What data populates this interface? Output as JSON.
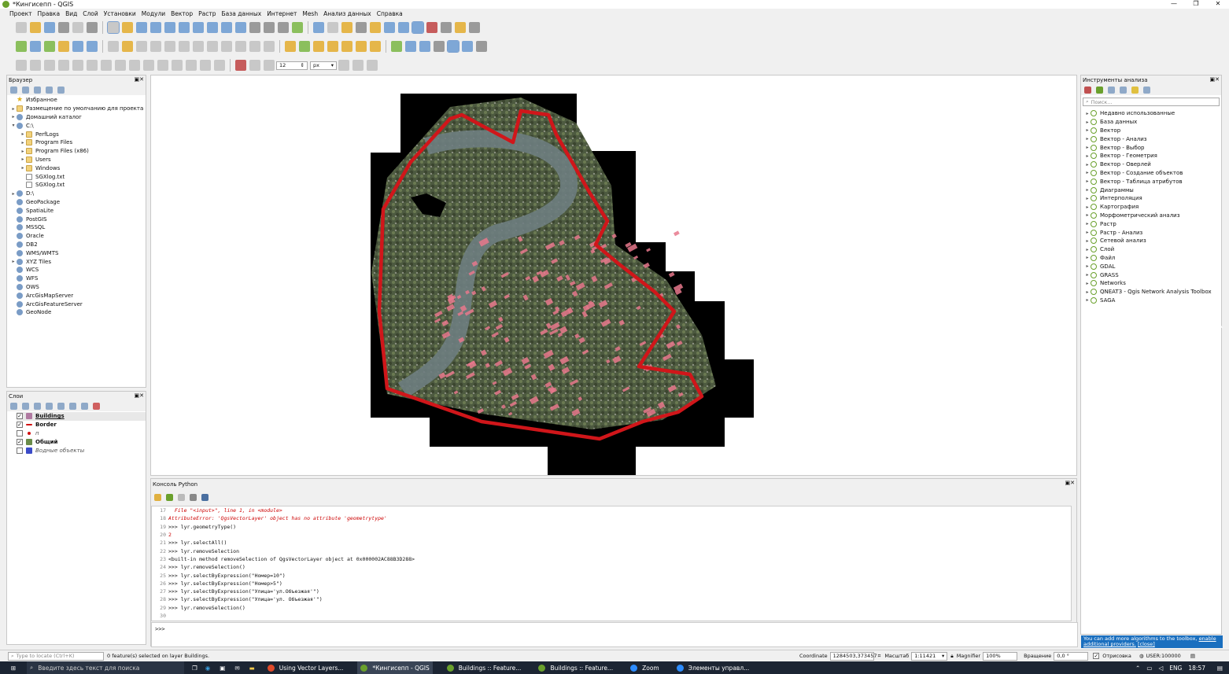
{
  "window": {
    "title": "*Кингисепп - QGIS",
    "controls": [
      "—",
      "❐",
      "✕"
    ]
  },
  "menu": [
    "Проект",
    "Правка",
    "Вид",
    "Слой",
    "Установки",
    "Модули",
    "Вектор",
    "Растр",
    "База данных",
    "Интернет",
    "Mesh",
    "Анализ данных",
    "Справка"
  ],
  "digitize": {
    "size_value": "12",
    "unit": "px"
  },
  "browser": {
    "title": "Браузер",
    "items": [
      {
        "label": "Избранное",
        "icon": "star-icon",
        "indent": 0,
        "arrow": ""
      },
      {
        "label": "Размещение по умолчанию для проекта",
        "icon": "folder-icon",
        "indent": 0,
        "arrow": "▸"
      },
      {
        "label": "Домашний каталог",
        "icon": "home-folder-icon",
        "indent": 0,
        "arrow": "▸"
      },
      {
        "label": "C:\\",
        "icon": "drive-icon",
        "indent": 0,
        "arrow": "▾"
      },
      {
        "label": "PerfLogs",
        "icon": "folder-icon",
        "indent": 1,
        "arrow": "▸"
      },
      {
        "label": "Program Files",
        "icon": "folder-icon",
        "indent": 1,
        "arrow": "▸"
      },
      {
        "label": "Program Files (x86)",
        "icon": "folder-icon",
        "indent": 1,
        "arrow": "▸"
      },
      {
        "label": "Users",
        "icon": "folder-icon",
        "indent": 1,
        "arrow": "▸"
      },
      {
        "label": "Windows",
        "icon": "folder-icon",
        "indent": 1,
        "arrow": "▸"
      },
      {
        "label": "SGXlog.txt",
        "icon": "file-icon",
        "indent": 1,
        "arrow": ""
      },
      {
        "label": "SGXlog.txt",
        "icon": "file-icon",
        "indent": 1,
        "arrow": ""
      },
      {
        "label": "D:\\",
        "icon": "drive-icon",
        "indent": 0,
        "arrow": "▸"
      },
      {
        "label": "GeoPackage",
        "icon": "geopackage-icon",
        "indent": 0,
        "arrow": ""
      },
      {
        "label": "SpatiaLite",
        "icon": "spatialite-icon",
        "indent": 0,
        "arrow": ""
      },
      {
        "label": "PostGIS",
        "icon": "postgis-icon",
        "indent": 0,
        "arrow": ""
      },
      {
        "label": "MSSQL",
        "icon": "mssql-icon",
        "indent": 0,
        "arrow": ""
      },
      {
        "label": "Oracle",
        "icon": "oracle-icon",
        "indent": 0,
        "arrow": ""
      },
      {
        "label": "DB2",
        "icon": "db2-icon",
        "indent": 0,
        "arrow": ""
      },
      {
        "label": "WMS/WMTS",
        "icon": "wms-icon",
        "indent": 0,
        "arrow": ""
      },
      {
        "label": "XYZ Tiles",
        "icon": "xyz-icon",
        "indent": 0,
        "arrow": "▸"
      },
      {
        "label": "WCS",
        "icon": "wcs-icon",
        "indent": 0,
        "arrow": ""
      },
      {
        "label": "WFS",
        "icon": "wfs-icon",
        "indent": 0,
        "arrow": ""
      },
      {
        "label": "OWS",
        "icon": "ows-icon",
        "indent": 0,
        "arrow": ""
      },
      {
        "label": "ArcGisMapServer",
        "icon": "arcgis-icon",
        "indent": 0,
        "arrow": ""
      },
      {
        "label": "ArcGisFeatureServer",
        "icon": "arcgis-icon",
        "indent": 0,
        "arrow": ""
      },
      {
        "label": "GeoNode",
        "icon": "geonode-icon",
        "indent": 0,
        "arrow": ""
      }
    ]
  },
  "layers": {
    "title": "Слои",
    "items": [
      {
        "label": "Buildings",
        "checked": true,
        "swatch": "#b07aa1",
        "bold": true,
        "italic": false,
        "selected": true
      },
      {
        "label": "Border",
        "checked": true,
        "swatch": "#d01010",
        "bold": true,
        "italic": false,
        "selected": false
      },
      {
        "label": "п",
        "checked": false,
        "swatch": "#d01010",
        "bold": false,
        "italic": true,
        "selected": false
      },
      {
        "label": "Общий",
        "checked": true,
        "swatch": "#6a8c4a",
        "bold": true,
        "italic": false,
        "selected": false
      },
      {
        "label": "Водные объекты",
        "checked": false,
        "swatch": "#3b4bc8",
        "bold": false,
        "italic": true,
        "selected": false
      }
    ]
  },
  "toolbox": {
    "title": "Инструменты анализа",
    "search_placeholder": "Поиск...",
    "items": [
      "Недавно использованные",
      "База данных",
      "Вектор",
      "Вектор - Анализ",
      "Вектор - Выбор",
      "Вектор - Геометрия",
      "Вектор - Оверлей",
      "Вектор - Создание объектов",
      "Вектор - Таблица атрибутов",
      "Диаграммы",
      "Интерполяция",
      "Картография",
      "Морфометрический анализ",
      "Растр",
      "Растр - Анализ",
      "Сетевой анализ",
      "Слой",
      "Файл",
      "GDAL",
      "GRASS",
      "Networks",
      "QNEAT3 - Qgis Network Analysis Toolbox",
      "SAGA"
    ],
    "hint_text": "You can add more algorithms to the toolbox, ",
    "hint_link": "enable additional providers.",
    "hint_close": "[close]"
  },
  "console": {
    "title": "Консоль Python",
    "lines": [
      {
        "n": "17",
        "text": "  File \"<input>\", line 1, in <module>",
        "cls": "err"
      },
      {
        "n": "18",
        "text": "AttributeError: 'QgsVectorLayer' object has no attribute 'geometrytype'",
        "cls": "err"
      },
      {
        "n": "19",
        "text": ">>> lyr.geometryType()",
        "cls": ""
      },
      {
        "n": "20",
        "text": "2",
        "cls": "str"
      },
      {
        "n": "21",
        "text": ">>> lyr.selectAll()",
        "cls": ""
      },
      {
        "n": "22",
        "text": ">>> lyr.removeSelection",
        "cls": ""
      },
      {
        "n": "23",
        "text": "<built-in method removeSelection of QgsVectorLayer object at 0x000002AC88B3D288>",
        "cls": ""
      },
      {
        "n": "24",
        "text": ">>> lyr.removeSelection()",
        "cls": ""
      },
      {
        "n": "25",
        "text": ">>> lyr.selectByExpression(\"Номер=10\")",
        "cls": ""
      },
      {
        "n": "26",
        "text": ">>> lyr.selectByExpression(\"Номер>5\")",
        "cls": ""
      },
      {
        "n": "27",
        "text": ">>> lyr.selectByExpression(\"Улица='ул.Объезжая'\")",
        "cls": ""
      },
      {
        "n": "28",
        "text": ">>> lyr.selectByExpression(\"Улица='ул. Объезжая'\")",
        "cls": ""
      },
      {
        "n": "29",
        "text": ">>> lyr.removeSelection()",
        "cls": ""
      },
      {
        "n": "30",
        "text": "",
        "cls": ""
      }
    ],
    "prompt": ">>>"
  },
  "status": {
    "locate_placeholder": "Type to locate (Ctrl+K)",
    "message": "0 feature(s) selected on layer Buildings.",
    "coordinate_label": "Coordinate",
    "coordinate_value": "1284503,373457",
    "scale_label": "Масштаб",
    "scale_value": "1:11421",
    "magnifier_label": "Magnifier",
    "magnifier_value": "100%",
    "rotation_label": "Вращение",
    "rotation_value": "0,0 °",
    "render_label": "Отрисовка",
    "crs": "USER:100000"
  },
  "taskbar": {
    "search_placeholder": "Введите здесь текст для поиска",
    "tasks": [
      {
        "label": "Using Vector Layers...",
        "color": "#e04a2a",
        "active": false
      },
      {
        "label": "*Кингисепп - QGIS",
        "color": "#6aa02c",
        "active": true
      },
      {
        "label": "Buildings :: Feature...",
        "color": "#6aa02c",
        "active": false
      },
      {
        "label": "Buildings :: Feature...",
        "color": "#6aa02c",
        "active": false
      },
      {
        "label": "Zoom",
        "color": "#2d8cff",
        "active": false
      },
      {
        "label": "Элементы управл...",
        "color": "#2d8cff",
        "active": false
      }
    ],
    "lang": "ENG",
    "time": "18:57"
  },
  "colors": {
    "border_line": "#d0161a",
    "buildings": "#e8788c",
    "ortho_bg": "#000000"
  }
}
